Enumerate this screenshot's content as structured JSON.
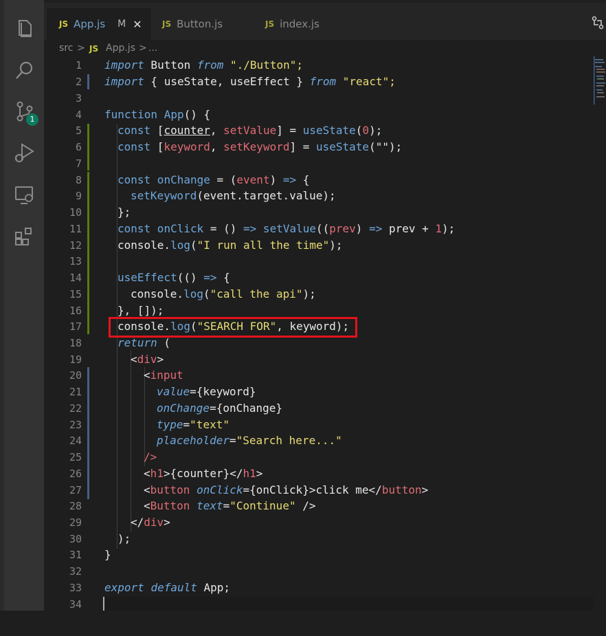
{
  "tabs": [
    {
      "js_badge": "JS",
      "name": "App.js",
      "modified": "M",
      "close": "✕"
    },
    {
      "js_badge": "JS",
      "name": "Button.js"
    },
    {
      "js_badge": "JS",
      "name": "index.js"
    }
  ],
  "breadcrumb": {
    "folder": "src",
    "sep1": ">",
    "js_badge": "JS",
    "file": "App.js",
    "sep2": ">",
    "more": "..."
  },
  "activity": {
    "source_control_badge": "1"
  },
  "line_numbers": [
    "1",
    "2",
    "3",
    "4",
    "5",
    "6",
    "7",
    "8",
    "9",
    "10",
    "11",
    "12",
    "13",
    "14",
    "15",
    "16",
    "17",
    "18",
    "19",
    "20",
    "21",
    "22",
    "23",
    "24",
    "25",
    "26",
    "27",
    "28",
    "29",
    "30",
    "31",
    "32",
    "33",
    "34"
  ],
  "code": {
    "l1": {
      "a": "import",
      "b": " Button ",
      "c": "from",
      "d": " \"./Button\";"
    },
    "l2": {
      "a": "import",
      "b": " { useState, useEffect } ",
      "c": "from",
      "d": " \"react\";"
    },
    "l4": {
      "a": "function",
      "b": " App",
      "c": "() {"
    },
    "l5": {
      "a": "const",
      "b": " [",
      "c": "counter",
      "d": ", ",
      "e": "setValue",
      "f": "] = ",
      "g": "useState",
      "h": "(",
      "i": "0",
      "j": ");"
    },
    "l6": {
      "a": "const",
      "b": " [",
      "c": "keyword",
      "d": ", ",
      "e": "setKeyword",
      "f": "] = ",
      "g": "useState",
      "h": "(\"\");"
    },
    "l8": {
      "a": "const",
      "b": " onChange",
      "c": " = (",
      "d": "event",
      "e": ") ",
      "f": "=>",
      "g": " {"
    },
    "l9": {
      "a": "setKeyword",
      "b": "(event.target.value);"
    },
    "l10": {
      "a": "};"
    },
    "l11": {
      "a": "const",
      "b": " onClick",
      "c": " = () ",
      "d": "=>",
      "e": " setValue",
      "f": "((",
      "g": "prev",
      "h": ") ",
      "i": "=>",
      "j": " prev + ",
      "k": "1",
      "l": ");"
    },
    "l12": {
      "a": "console.",
      "b": "log",
      "c": "(",
      "d": "\"I run all the time\"",
      "e": ");"
    },
    "l14": {
      "a": "useEffect",
      "b": "(() ",
      "c": "=>",
      "d": " {"
    },
    "l15": {
      "a": "console.",
      "b": "log",
      "c": "(",
      "d": "\"call the api\"",
      "e": ");"
    },
    "l16": {
      "a": "}, []);"
    },
    "l17": {
      "a": "console.",
      "b": "log",
      "c": "(",
      "d": "\"SEARCH FOR\"",
      "e": ", keyword);"
    },
    "l18": {
      "a": "return",
      "b": " ("
    },
    "l19": {
      "a": "<",
      "b": "div",
      "c": ">"
    },
    "l20": {
      "a": "<",
      "b": "input"
    },
    "l21": {
      "a": "value",
      "b": "={",
      "c": "keyword",
      "d": "}"
    },
    "l22": {
      "a": "onChange",
      "b": "={",
      "c": "onChange",
      "d": "}"
    },
    "l23": {
      "a": "type",
      "b": "=",
      "c": "\"text\""
    },
    "l24": {
      "a": "placeholder",
      "b": "=",
      "c": "\"Search here...\""
    },
    "l25": {
      "a": "/>"
    },
    "l26": {
      "a": "<",
      "b": "h1",
      "c": ">{counter}</",
      "d": "h1",
      "e": ">"
    },
    "l27": {
      "a": "<",
      "b": "button",
      "c": " ",
      "d": "onClick",
      "e": "={onClick}>click me</",
      "f": "button",
      "g": ">"
    },
    "l28": {
      "a": "<",
      "b": "Button",
      "c": " ",
      "d": "text",
      "e": "=",
      "f": "\"Continue\"",
      "g": " />"
    },
    "l29": {
      "a": "</",
      "b": "div",
      "c": ">"
    },
    "l30": {
      "a": ");"
    },
    "l31": {
      "a": "}"
    },
    "l33": {
      "a": "export",
      "b": " ",
      "c": "default",
      "d": " App;"
    }
  },
  "colors": {
    "accent_highlight": "#e3141b",
    "background": "#1e1e1e"
  }
}
